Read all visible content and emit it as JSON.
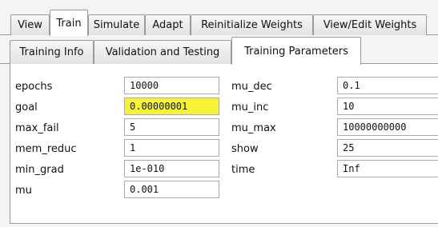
{
  "main_tabs": [
    {
      "label": "View"
    },
    {
      "label": "Train"
    },
    {
      "label": "Simulate"
    },
    {
      "label": "Adapt"
    },
    {
      "label": "Reinitialize Weights"
    },
    {
      "label": "View/Edit Weights"
    }
  ],
  "sub_tabs": [
    {
      "label": "Training Info"
    },
    {
      "label": "Validation and Testing"
    },
    {
      "label": "Training Parameters"
    }
  ],
  "params": {
    "epochs": {
      "label": "epochs",
      "value": "10000"
    },
    "goal": {
      "label": "goal",
      "value": "0.00000001"
    },
    "max_fail": {
      "label": "max_fail",
      "value": "5"
    },
    "mem_reduc": {
      "label": "mem_reduc",
      "value": "1"
    },
    "min_grad": {
      "label": "min_grad",
      "value": "1e-010"
    },
    "mu": {
      "label": "mu",
      "value": "0.001"
    },
    "mu_dec": {
      "label": "mu_dec",
      "value": "0.1"
    },
    "mu_inc": {
      "label": "mu_inc",
      "value": "10"
    },
    "mu_max": {
      "label": "mu_max",
      "value": "10000000000"
    },
    "show": {
      "label": "show",
      "value": "25"
    },
    "time": {
      "label": "time",
      "value": "Inf"
    }
  },
  "colors": {
    "goal_highlight": "#f6f236"
  }
}
